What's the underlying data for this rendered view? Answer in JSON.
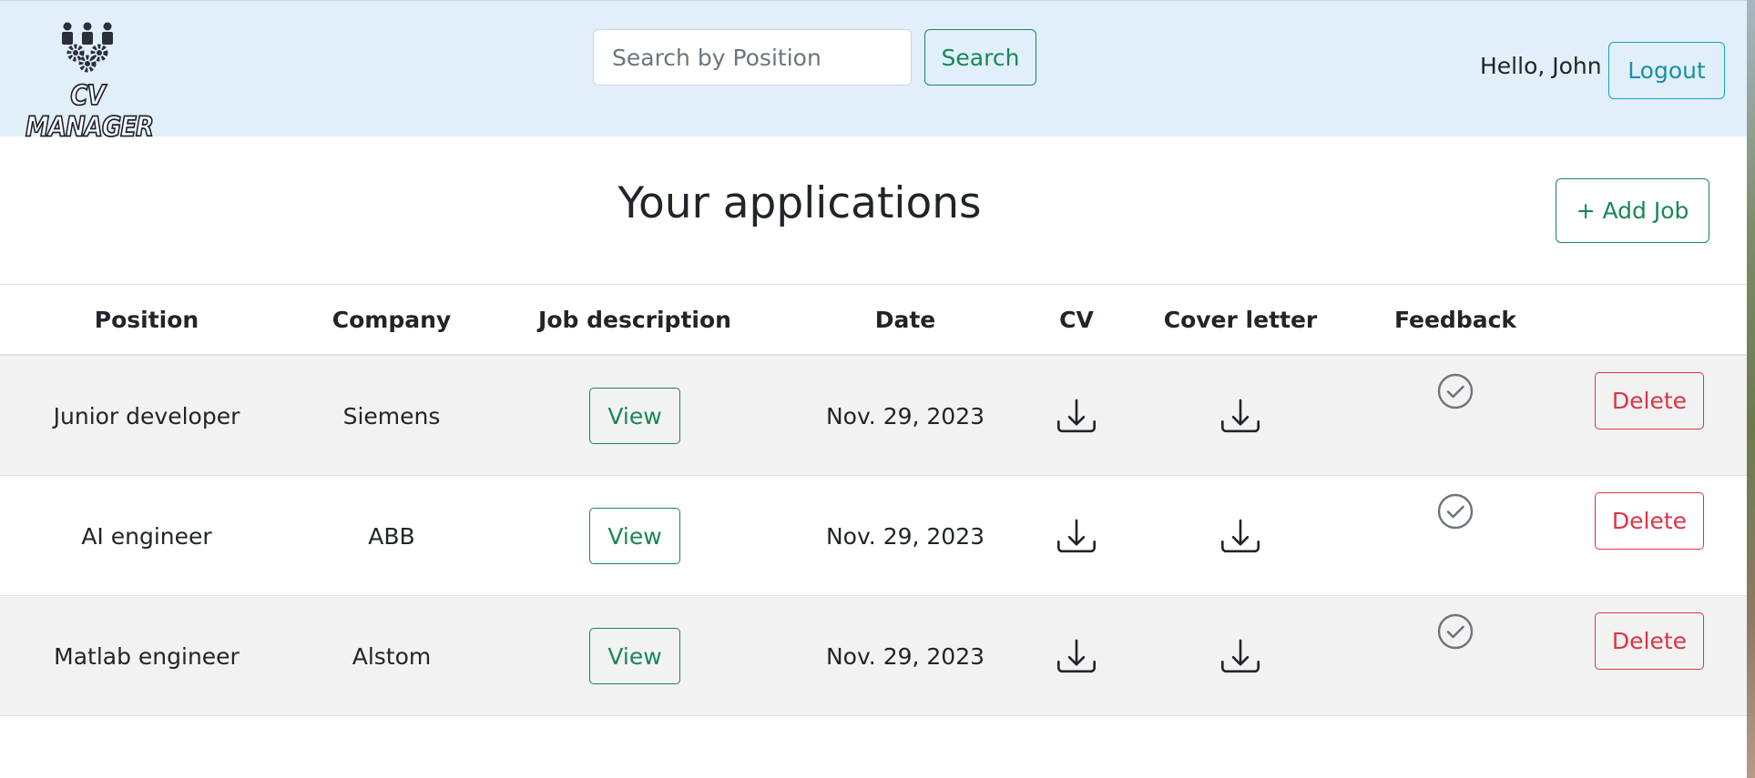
{
  "header": {
    "logo_text": "CV MANAGER",
    "search": {
      "placeholder": "Search by Position",
      "button_label": "Search"
    },
    "greeting": "Hello, John",
    "logout_label": "Logout"
  },
  "main": {
    "title": "Your applications",
    "add_job_label": "+ Add Job"
  },
  "table": {
    "columns": [
      "Position",
      "Company",
      "Job description",
      "Date",
      "CV",
      "Cover letter",
      "Feedback",
      ""
    ],
    "rows": [
      {
        "position": "Junior developer",
        "company": "Siemens",
        "job_description_label": "View",
        "date": "Nov. 29, 2023",
        "cv_icon": "download-icon",
        "cover_letter_icon": "download-icon",
        "feedback_icon": "check-circle-icon",
        "delete_label": "Delete"
      },
      {
        "position": "AI engineer",
        "company": "ABB",
        "job_description_label": "View",
        "date": "Nov. 29, 2023",
        "cv_icon": "download-icon",
        "cover_letter_icon": "download-icon",
        "feedback_icon": "check-circle-icon",
        "delete_label": "Delete"
      },
      {
        "position": "Matlab engineer",
        "company": "Alstom",
        "job_description_label": "View",
        "date": "Nov. 29, 2023",
        "cv_icon": "download-icon",
        "cover_letter_icon": "download-icon",
        "feedback_icon": "check-circle-icon",
        "delete_label": "Delete"
      }
    ]
  },
  "colors": {
    "header_background": "#e1effb",
    "success": "#198754",
    "danger": "#dc3545",
    "info": "#17a2b8",
    "stripe": "#f2f2f2"
  }
}
